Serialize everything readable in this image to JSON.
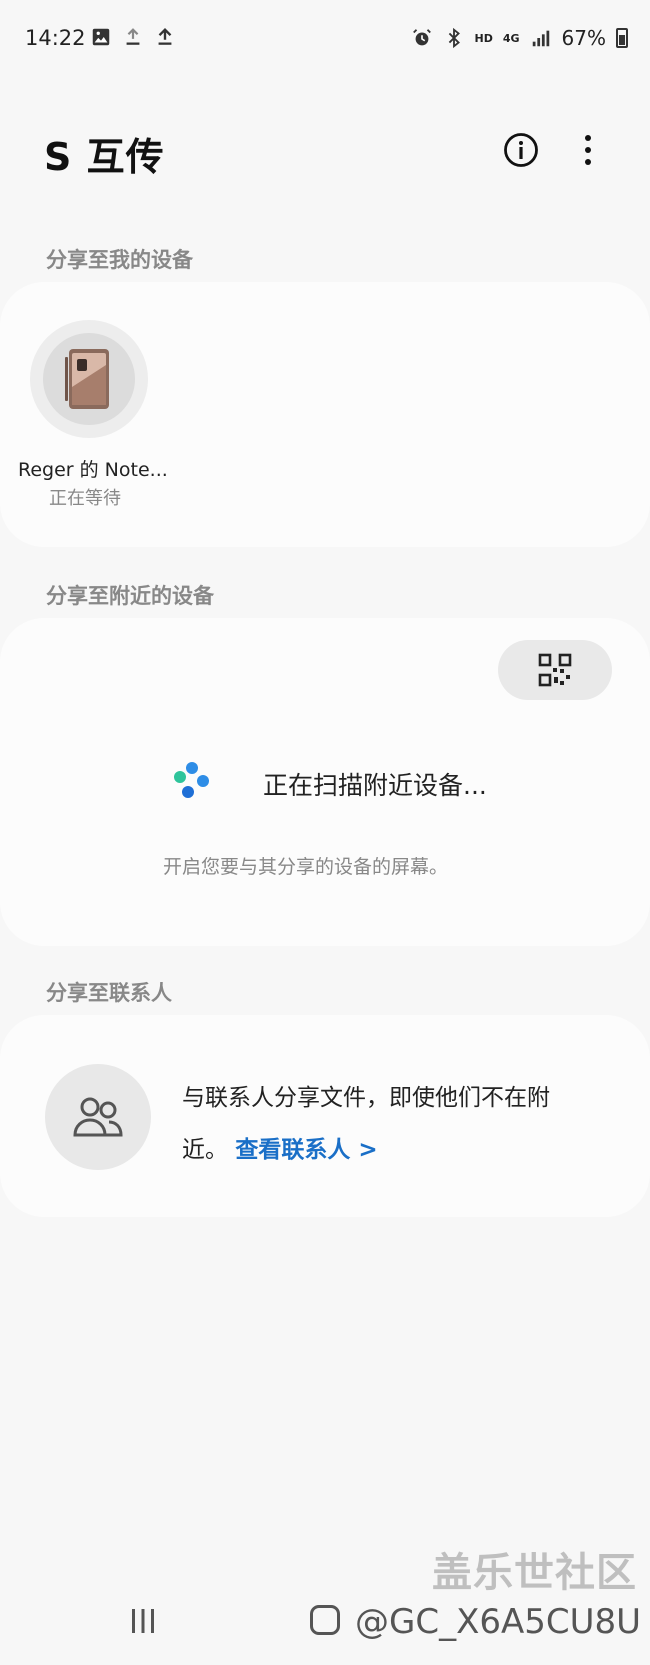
{
  "status_bar": {
    "time": "14:22",
    "battery": "67%",
    "network_hd": "HD",
    "network_4g": "4G",
    "icons": [
      "image-icon",
      "download-icon",
      "upload-icon",
      "alarm-icon",
      "bluetooth-icon",
      "signal-icon",
      "battery-icon"
    ]
  },
  "header": {
    "title": "S 互传",
    "info_icon": "info-icon",
    "more_icon": "more-vertical-icon"
  },
  "my_devices": {
    "section_label": "分享至我的设备",
    "devices": [
      {
        "name": "Reger 的 Note...",
        "status": "正在等待"
      }
    ]
  },
  "nearby": {
    "section_label": "分享至附近的设备",
    "qr_icon": "qr-code-icon",
    "scanning_text": "正在扫描附近设备...",
    "hint": "开启您要与其分享的设备的屏幕。"
  },
  "contacts": {
    "section_label": "分享至联系人",
    "description": "与联系人分享文件，即使他们不在附近。",
    "link_label": "查看联系人 >"
  },
  "watermark": {
    "site": "盖乐世社区",
    "user": "@GC_X6A5CU8U"
  }
}
